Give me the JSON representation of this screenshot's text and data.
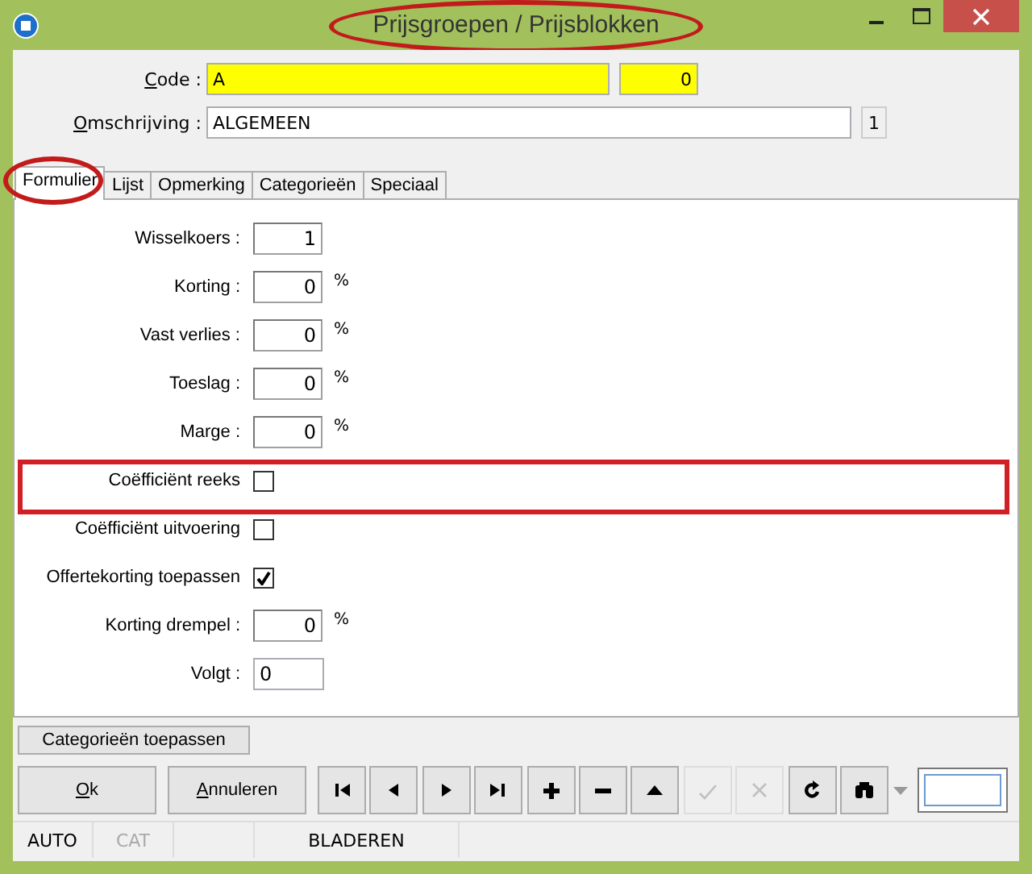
{
  "window": {
    "title": "Prijsgroepen / Prijsblokken",
    "title_circled": true
  },
  "header": {
    "code": {
      "label": "Code :",
      "accel": true,
      "value": "A",
      "number": "0"
    },
    "description": {
      "label": "Omschrijving :",
      "accel": true,
      "value": "ALGEMEEN",
      "badge": "1"
    }
  },
  "tabs": [
    {
      "label": "Formulier",
      "selected": true,
      "circled": true
    },
    {
      "label": "Lijst",
      "selected": false,
      "circled": false
    },
    {
      "label": "Opmerking",
      "selected": false,
      "circled": false
    },
    {
      "label": "Categorieën",
      "selected": false,
      "circled": false
    },
    {
      "label": "Speciaal",
      "selected": false,
      "circled": false
    }
  ],
  "rows": [
    {
      "kind": "number",
      "label": "Wisselkoers :",
      "value": "1",
      "highlighted": false
    },
    {
      "kind": "number",
      "label": "Korting :",
      "value": "0",
      "unit": "%",
      "highlighted": false
    },
    {
      "kind": "number",
      "label": "Vast verlies :",
      "value": "0",
      "unit": "%",
      "highlighted": false
    },
    {
      "kind": "number",
      "label": "Toeslag :",
      "value": "0",
      "unit": "%",
      "highlighted": false
    },
    {
      "kind": "number",
      "label": "Marge :",
      "value": "0",
      "unit": "%",
      "highlighted": false
    },
    {
      "kind": "checkbox",
      "label": "Coëfficiënt reeks",
      "checked": false,
      "highlighted": true
    },
    {
      "kind": "checkbox",
      "label": "Coëfficiënt uitvoering",
      "checked": false,
      "highlighted": false
    },
    {
      "kind": "checkbox",
      "label": "Offertekorting toepassen",
      "checked": true,
      "highlighted": false
    },
    {
      "kind": "number",
      "label": "Korting drempel :",
      "value": "0",
      "unit": "%",
      "highlighted": false
    },
    {
      "kind": "text",
      "label": "Volgt :",
      "value": "0",
      "highlighted": false
    }
  ],
  "apply_button": "Categorieën toepassen",
  "buttons": [
    {
      "label": "Ok",
      "accel": true
    },
    {
      "label": "Annuleren",
      "accel": true
    }
  ],
  "toolbar": [
    {
      "kind": "first",
      "disabled": false
    },
    {
      "kind": "prev",
      "disabled": false
    },
    {
      "kind": "next",
      "disabled": false
    },
    {
      "kind": "last",
      "disabled": false
    },
    {
      "kind": "add",
      "disabled": false
    },
    {
      "kind": "remove",
      "disabled": false
    },
    {
      "kind": "up",
      "disabled": false
    },
    {
      "kind": "confirm",
      "disabled": true
    },
    {
      "kind": "cancel",
      "disabled": true
    },
    {
      "kind": "refresh",
      "disabled": false
    },
    {
      "kind": "find",
      "disabled": false
    }
  ],
  "status_bar": [
    {
      "text": "AUTO",
      "disabled": false
    },
    {
      "text": "CAT",
      "disabled": true
    },
    {
      "text": "BLADEREN",
      "disabled": false
    }
  ]
}
